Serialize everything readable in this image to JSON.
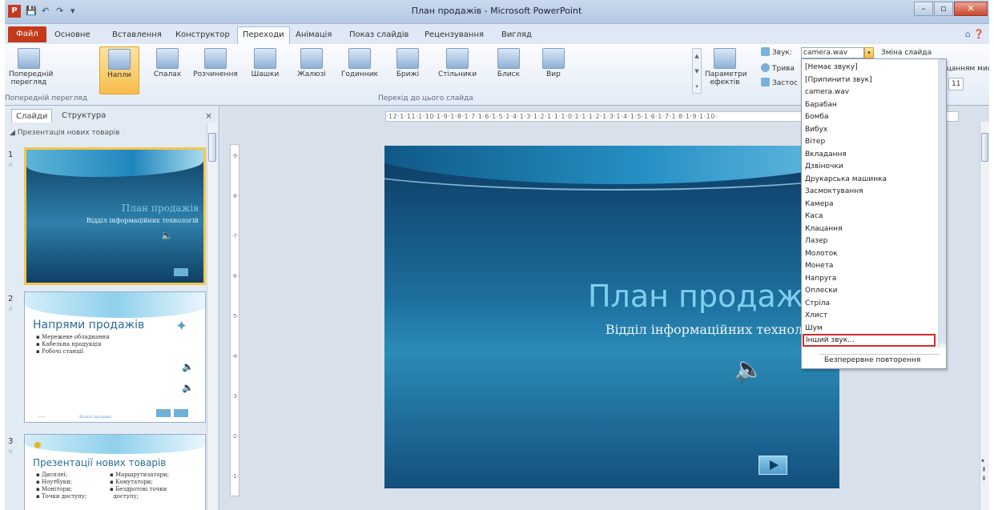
{
  "window": {
    "title": "План продажів - Microsoft PowerPoint",
    "min": "–",
    "max": "▫",
    "close": "✕"
  },
  "qat": {
    "app_icon": "P",
    "save": "💾",
    "undo": "↶",
    "redo": "↷",
    "more": "▾"
  },
  "tabs": [
    "Файл",
    "Основне",
    "Вставлення",
    "Конструктор",
    "Переходи",
    "Анімація",
    "Показ слайдів",
    "Рецензування",
    "Вигляд"
  ],
  "ribbon": {
    "preview": "Попередній перегляд",
    "transitions": [
      "Напли",
      "Спалах",
      "Розчинення",
      "Шашки",
      "Жалюзі",
      "Годинник",
      "Брижі",
      "Стільники",
      "Блиск",
      "Вир"
    ],
    "effect_options": "Параметри ефектів",
    "group_preview_label": "Попередній перегляд",
    "group_transitions_label": "Перехід до цього слайда",
    "sound_label": "Звук:",
    "sound_value": "camera.wav",
    "duration_label": "Трива",
    "apply_label": "Застос",
    "advance_label": "Зміна слайда",
    "mouse_label": "клацанням миші",
    "time_value": "11"
  },
  "pane": {
    "tab_slides": "Слайди",
    "tab_outline": "Структура",
    "close": "×",
    "section": "◢ Презентація нових товарів",
    "slides": [
      {
        "num": "1",
        "title": "План продажів",
        "subtitle": "Відділ інформаційних технологій"
      },
      {
        "num": "2",
        "title": "Напрями продажів",
        "bullets": [
          "Мережеве обладнання",
          "Кабельна продукція",
          "Робочі станції"
        ],
        "footer": [
          "——",
          "Відділ продажу"
        ]
      },
      {
        "num": "3",
        "title": "Презентації нових товарів",
        "bullets_left": [
          "Дисплеї;",
          "Ноутбуки;",
          "Монітори;",
          "Точки доступу;"
        ],
        "bullets_right": [
          "Маршрутизатори;",
          "Комутатори;",
          "Бездротові точки",
          "доступу;"
        ]
      }
    ]
  },
  "ruler": "·12·1·11·1·10·1·9·1·8·1·7·1·6·1·5·1·4·1·3·1·2·1·1·1·0·1·1·1·2·1·3·1·4·1·5·1·6·1·7·1·8·1·9·1·10·",
  "slide": {
    "title": "План продажів",
    "subtitle": "Відділ інформаційних технологій"
  },
  "dropdown": {
    "items": [
      "[Немає звуку]",
      "[Припинити звук]",
      "camera.wav",
      "Барабан",
      "Бомба",
      "Вибух",
      "Вітер",
      "Вкладання",
      "Дзвіночки",
      "Друкарська машинка",
      "Засмоктування",
      "Камера",
      "Каса",
      "Клацання",
      "Лазер",
      "Молоток",
      "Монета",
      "Напруга",
      "Оплески",
      "Стріла",
      "Хлист",
      "Шум"
    ],
    "other": "Інший звук...",
    "loop": "Безперервне повторення"
  },
  "colors": {
    "accent": "#c4391a",
    "highlight": "#d42a2a",
    "slide_title": "#7fd0ef"
  }
}
